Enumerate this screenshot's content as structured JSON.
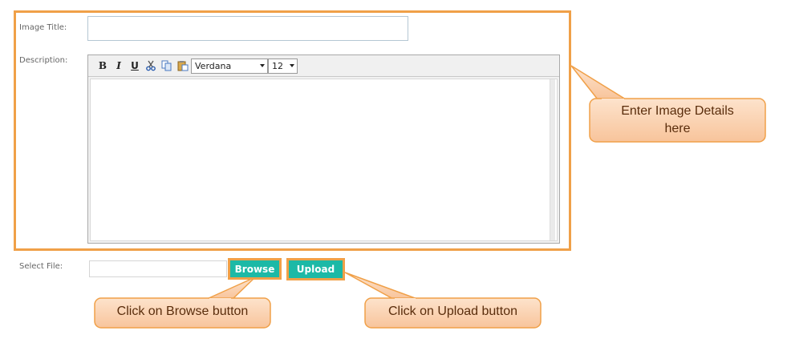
{
  "form": {
    "image_title_label": "Image Title:",
    "description_label": "Description:",
    "select_file_label": "Select File:",
    "image_title_value": "",
    "file_value": ""
  },
  "editor": {
    "bold": "B",
    "italic": "I",
    "underline": "U",
    "font_value": "Verdana",
    "size_value": "12"
  },
  "buttons": {
    "browse": "Browse",
    "upload": "Upload"
  },
  "callouts": {
    "details_line1": "Enter Image Details",
    "details_line2": "here",
    "browse": "Click on Browse button",
    "upload": "Click on Upload button"
  },
  "colors": {
    "highlight": "#f0a048",
    "button": "#1cb9a6",
    "callout_fill": "#fcd3b0"
  }
}
